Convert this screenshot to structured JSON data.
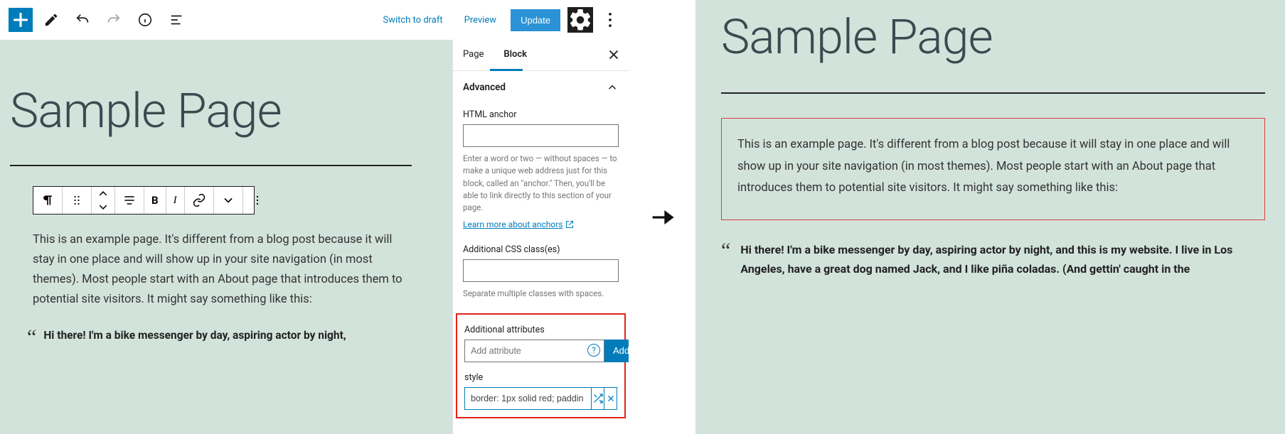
{
  "topbar": {
    "switch_to_draft": "Switch to draft",
    "preview": "Preview",
    "update": "Update"
  },
  "canvas": {
    "title": "Sample Page",
    "paragraph": "This is an example page. It's different from a blog post because it will stay in one place and will show up in your site navigation (in most themes). Most people start with an About page that introduces them to potential site visitors. It might say something like this:",
    "quote": "Hi there! I'm a bike messenger by day, aspiring actor by night,"
  },
  "sidebar": {
    "tabs": {
      "page": "Page",
      "block": "Block"
    },
    "advanced_panel": "Advanced",
    "html_anchor": {
      "label": "HTML anchor",
      "help": "Enter a word or two — without spaces — to make a unique web address just for this block, called an \"anchor.\" Then, you'll be able to link directly to this section of your page.",
      "learn_more": "Learn more about anchors"
    },
    "css_classes": {
      "label": "Additional CSS class(es)",
      "help": "Separate multiple classes with spaces."
    },
    "additional_attributes": {
      "label": "Additional attributes",
      "placeholder": "Add attribute",
      "add_button": "Add"
    },
    "style_attr": {
      "label": "style",
      "value": "border: 1px solid red; paddin"
    }
  },
  "preview": {
    "title": "Sample Page",
    "paragraph": "This is an example page. It's different from a blog post because it will stay in one place and will show up in your site navigation (in most themes). Most people start with an About page that introduces them to potential site visitors. It might say something like this:",
    "quote": "Hi there! I'm a bike messenger by day, aspiring actor by night, and this is my website. I live in Los Angeles, have a great dog named Jack, and I like piña coladas. (And gettin' caught in the"
  }
}
